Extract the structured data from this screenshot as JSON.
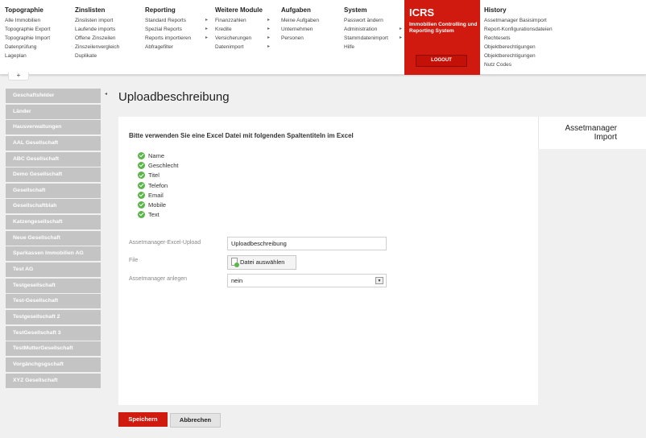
{
  "menu": {
    "topographie": {
      "title": "Topographie",
      "items": [
        "Alle Immobilien",
        "Topographie Export",
        "Topographie Import",
        "Datenprüfung",
        "Lageplan"
      ]
    },
    "zinslisten": {
      "title": "Zinslisten",
      "items": [
        "Zinslisten import",
        "Laufende imports",
        "Offene Zinszeilen",
        "Zinszeilenvergleich",
        "Duplikate"
      ]
    },
    "reporting": {
      "title": "Reporting",
      "items": [
        "Standard Reports",
        "Spezial Reports",
        "Reports importieren",
        "Abfragefilter"
      ]
    },
    "weitere": {
      "title": "Weitere Module",
      "items": [
        "Finanzzahlen",
        "Kredite",
        "Versicherungen",
        "Datenimport"
      ]
    },
    "aufgaben": {
      "title": "Aufgaben",
      "items": [
        "Meine Aufgaben",
        "Unternehmen",
        "Personen"
      ]
    },
    "system": {
      "title": "System",
      "items": [
        "Passwort ändern",
        "Administration",
        "Stammdatenimport",
        "Hilfe"
      ]
    },
    "history": {
      "title": "History",
      "items": [
        "Assetmanager Basisimport",
        "Report-Konfigurationsdateien",
        "Rechtesets",
        "Objektberechtigungen",
        "Objektberechtigungen",
        "Nutz Codes"
      ]
    }
  },
  "brand": {
    "logo": "ICRS",
    "subtitle": "Immobilien Controlling und Reporting System",
    "logout_label": "LOGOUT",
    "color": "#d0190f"
  },
  "plus_tab": "+",
  "sidebar_toggle": "◂",
  "sidebar": [
    "Geschaftsfelder",
    "Länder",
    "Hausverwaltungen",
    "AAL Gesellschaft",
    "ABC Gesellschaft",
    "Demo Gesellschaft",
    "Gesellschaft",
    "Gesellschaftblah",
    "Katzengesellschaft",
    "Neue Gesellschaft",
    "Sparkassen Immobilien AG",
    "Test AG",
    "Testgesellschaft",
    "Test-Gesellschaft",
    "Testgesellschaft 2",
    "TestGesellschaft 3",
    "TestMutterGesellschaft",
    "Vorgänchgsgschaft",
    "XYZ Gesellschaft"
  ],
  "page": {
    "title": "Uploadbeschreibung",
    "headline": "Bitte verwenden Sie eine Excel Datei mit folgenden Spaltentiteln im Excel",
    "assetbox_line1": "Assetmanager",
    "assetbox_line2": "Import",
    "columns": [
      "Name",
      "Geschlecht",
      "Titel",
      "Telefon",
      "Email",
      "Mobile",
      "Text"
    ]
  },
  "form": {
    "upload_label": "Assetmanager-Excel-Upload",
    "upload_value": "Uploadbeschreibung",
    "file_label": "File",
    "file_button": "Datei auswählen",
    "anlegen_label": "Assetmanager anlegen",
    "anlegen_value": "nein"
  },
  "actions": {
    "save": "Speichern",
    "cancel": "Abbrechen"
  }
}
